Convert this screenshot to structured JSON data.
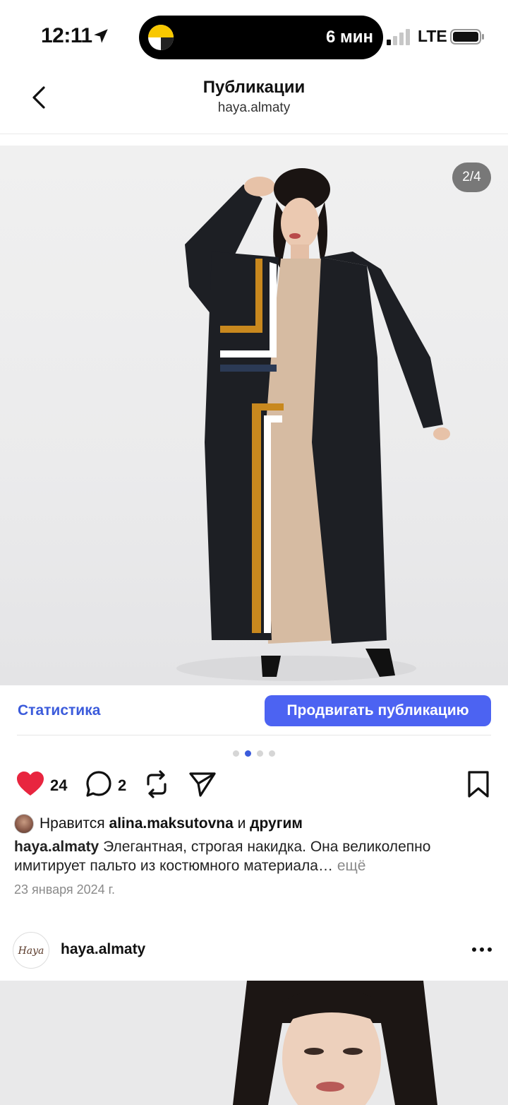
{
  "status_bar": {
    "time": "12:11",
    "island_text": "6 мин",
    "network": "LTE"
  },
  "header": {
    "title": "Публикации",
    "subtitle": "haya.almaty"
  },
  "post": {
    "image_counter": "2/4",
    "statistics_label": "Статистика",
    "promote_label": "Продвигать публикацию",
    "carousel_total": 4,
    "carousel_active": 2,
    "likes_count": "24",
    "comments_count": "2",
    "liked_by_prefix": "Нравится",
    "liked_by_user": "alina.maksutovna",
    "liked_by_and": "и",
    "liked_by_others": "другим",
    "caption_user": "haya.almaty",
    "caption_text": "Элегантная, строгая накидка. Она великолепно имитирует пальто из костюмного материала…",
    "caption_more": "ещё",
    "date": "23 января 2024 г."
  },
  "next_post": {
    "avatar_text": "Haya",
    "username": "haya.almaty"
  },
  "colors": {
    "accent": "#4c63f2",
    "link": "#3b5bdb",
    "like": "#e8253f"
  }
}
